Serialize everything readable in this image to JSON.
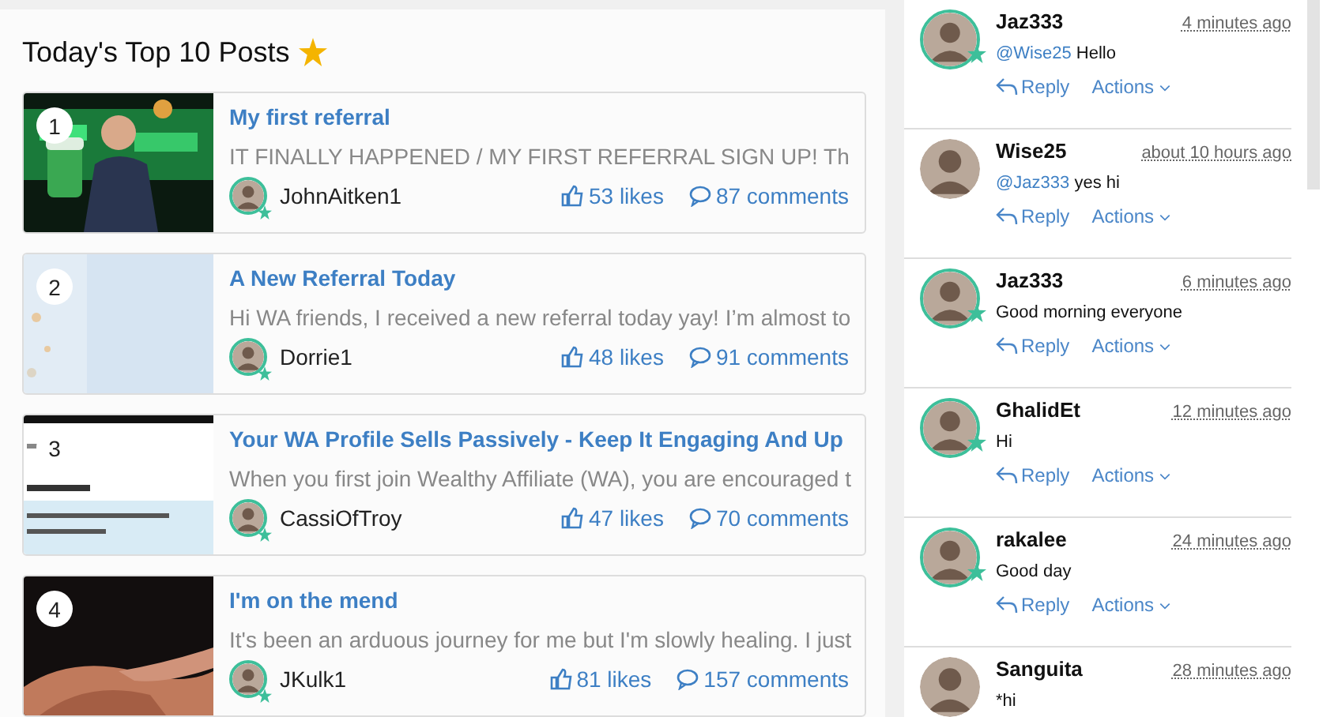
{
  "posts_panel": {
    "title": "Today's Top 10 Posts",
    "posts": [
      {
        "rank": "1",
        "title": "My first referral",
        "excerpt": "IT FINALLY HAPPENED / MY FIRST REFERRAL SIGN UP! Th",
        "author": "JohnAitken1",
        "premium": true,
        "likes": "53 likes",
        "comments": "87 comments"
      },
      {
        "rank": "2",
        "title": "A New Referral Today",
        "excerpt": "Hi WA friends, I received a new referral today yay! I’m almost to",
        "author": "Dorrie1",
        "premium": true,
        "likes": "48 likes",
        "comments": "91 comments"
      },
      {
        "rank": "3",
        "title": "Your WA Profile Sells Passively - Keep It Engaging And Up",
        "excerpt": "When you first join Wealthy Affiliate (WA), you are encouraged t",
        "author": "CassiOfTroy",
        "premium": true,
        "likes": "47 likes",
        "comments": "70 comments"
      },
      {
        "rank": "4",
        "title": "I'm on the mend",
        "excerpt": "It's been an arduous journey for me but I'm slowly healing. I just",
        "author": "JKulk1",
        "premium": true,
        "likes": "81 likes",
        "comments": "157 comments"
      }
    ]
  },
  "comments": [
    {
      "name": "Jaz333",
      "time": "4 minutes ago",
      "mention": "@Wise25",
      "text": "Hello",
      "premium": true,
      "reply": "Reply",
      "actions": "Actions"
    },
    {
      "name": "Wise25",
      "time": "about 10 hours ago",
      "mention": "@Jaz333",
      "text": "yes hi",
      "premium": false,
      "reply": "Reply",
      "actions": "Actions"
    },
    {
      "name": "Jaz333",
      "time": "6 minutes ago",
      "text": "Good morning everyone",
      "premium": true,
      "reply": "Reply",
      "actions": "Actions"
    },
    {
      "name": "GhalidEt",
      "time": "12 minutes ago",
      "text": "Hi",
      "premium": true,
      "reply": "Reply",
      "actions": "Actions"
    },
    {
      "name": "rakalee",
      "time": "24 minutes ago",
      "text": "Good day",
      "premium": true,
      "reply": "Reply",
      "actions": "Actions"
    },
    {
      "name": "Sanguita",
      "time": "28 minutes ago",
      "text": "*hi",
      "premium": false
    }
  ]
}
